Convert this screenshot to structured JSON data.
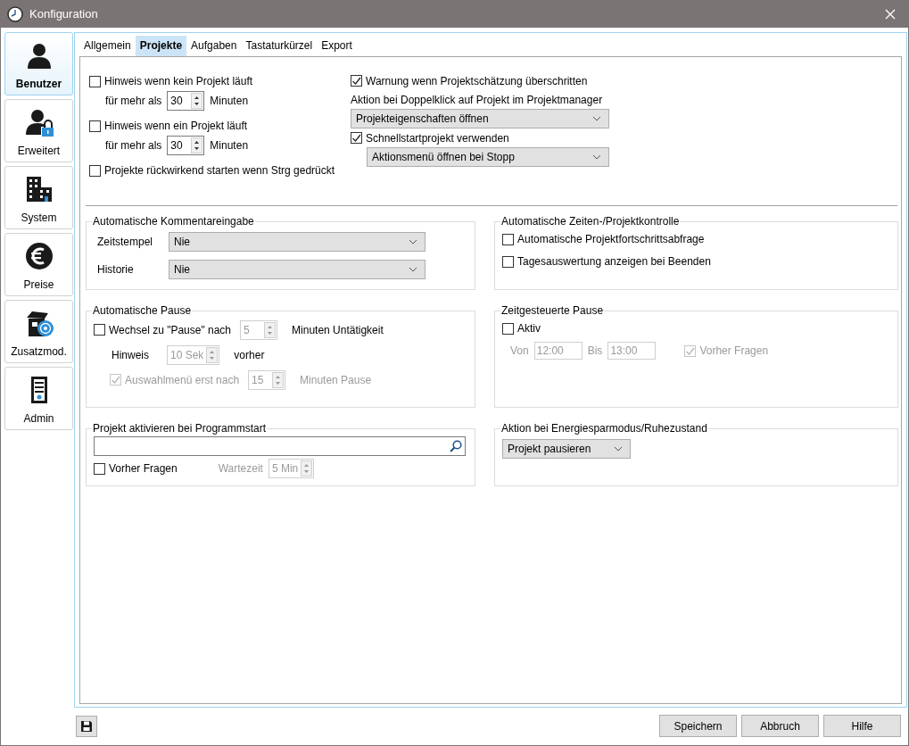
{
  "window": {
    "title": "Konfiguration"
  },
  "sidebar": {
    "items": [
      {
        "label": "Benutzer",
        "kind": "user",
        "selected": true
      },
      {
        "label": "Erweitert",
        "kind": "user-lock",
        "selected": false
      },
      {
        "label": "System",
        "kind": "building",
        "selected": false
      },
      {
        "label": "Preise",
        "kind": "euro",
        "selected": false
      },
      {
        "label": "Zusatzmod.",
        "kind": "box",
        "selected": false
      },
      {
        "label": "Admin",
        "kind": "server",
        "selected": false
      }
    ]
  },
  "tabs": [
    {
      "label": "Allgemein",
      "selected": false
    },
    {
      "label": "Projekte",
      "selected": true
    },
    {
      "label": "Aufgaben",
      "selected": false
    },
    {
      "label": "Tastaturkürzel",
      "selected": false
    },
    {
      "label": "Export",
      "selected": false
    }
  ],
  "top": {
    "left": [
      {
        "kind": "line",
        "items": [
          {
            "kind": "checkbox",
            "label": "Hinweis wenn kein Projekt läuft",
            "checked": false,
            "disabled": false
          }
        ]
      },
      {
        "kind": "indent",
        "items": [
          {
            "kind": "text",
            "text": "für mehr als",
            "disabled": false
          },
          {
            "kind": "spin",
            "value": "30",
            "disabled": false
          },
          {
            "kind": "text",
            "text": "Minuten",
            "disabled": false
          }
        ]
      },
      {
        "kind": "line",
        "items": [
          {
            "kind": "checkbox",
            "label": "Hinweis wenn ein Projekt läuft",
            "checked": false,
            "disabled": false
          }
        ]
      },
      {
        "kind": "indent",
        "items": [
          {
            "kind": "text",
            "text": "für mehr als",
            "disabled": false
          },
          {
            "kind": "spin",
            "value": "30",
            "disabled": false
          },
          {
            "kind": "text",
            "text": "Minuten",
            "disabled": false
          }
        ]
      },
      {
        "kind": "line",
        "items": [
          {
            "kind": "checkbox",
            "label": "Projekte rückwirkend starten wenn Strg gedrückt",
            "checked": false,
            "disabled": false
          }
        ]
      }
    ],
    "right": [
      {
        "kind": "line",
        "items": [
          {
            "kind": "checkbox",
            "label": "Warnung wenn Projektschätzung überschritten",
            "checked": true,
            "disabled": false
          }
        ]
      },
      {
        "kind": "line",
        "items": [
          {
            "kind": "text",
            "text": "Aktion bei Doppelklick auf Projekt im Projektmanager",
            "disabled": false
          }
        ]
      },
      {
        "kind": "line",
        "items": [
          {
            "kind": "select",
            "value": "Projekteigenschaften öffnen"
          }
        ]
      },
      {
        "kind": "line",
        "items": [
          {
            "kind": "checkbox",
            "label": "Schnellstartprojekt verwenden",
            "checked": true,
            "disabled": false
          }
        ]
      },
      {
        "kind": "indent",
        "items": [
          {
            "kind": "select",
            "value": "Aktionsmenü öffnen bei Stopp"
          }
        ]
      }
    ]
  },
  "groups": [
    {
      "title": "Automatische Kommentareingabe",
      "rows": [
        {
          "kind": "line",
          "items": [
            {
              "kind": "label",
              "text": "Zeitstempel",
              "disabled": false
            },
            {
              "kind": "select",
              "value": "Nie"
            }
          ]
        },
        {
          "kind": "line",
          "items": [
            {
              "kind": "label",
              "text": "Historie",
              "disabled": false
            },
            {
              "kind": "select",
              "value": "Nie"
            }
          ]
        }
      ]
    },
    {
      "title": "Automatische Zeiten-/Projektkontrolle",
      "rows": [
        {
          "kind": "line",
          "items": [
            {
              "kind": "checkbox",
              "label": "Automatische Projektfortschrittsabfrage",
              "checked": false,
              "disabled": false
            }
          ]
        },
        {
          "kind": "line",
          "items": [
            {
              "kind": "checkbox",
              "label": "Tagesauswertung anzeigen bei Beenden",
              "checked": false,
              "disabled": false
            }
          ]
        }
      ]
    },
    {
      "title": "Automatische Pause",
      "rows": [
        {
          "kind": "line",
          "items": [
            {
              "kind": "checkbox",
              "label": "Wechsel zu \"Pause\" nach",
              "checked": false,
              "disabled": false
            },
            {
              "kind": "spin",
              "value": "5",
              "disabled": true
            },
            {
              "kind": "text",
              "text": "Minuten Untätigkeit",
              "disabled": false
            }
          ]
        },
        {
          "kind": "indent",
          "items": [
            {
              "kind": "label",
              "text": "Hinweis",
              "disabled": false
            },
            {
              "kind": "spin",
              "value": "10 Sek",
              "disabled": true
            },
            {
              "kind": "text",
              "text": "vorher",
              "disabled": false
            }
          ]
        },
        {
          "kind": "indent",
          "items": [
            {
              "kind": "checkbox",
              "label": "Auswahlmenü erst nach",
              "checked": true,
              "disabled": true
            },
            {
              "kind": "spin",
              "value": "15",
              "disabled": true
            },
            {
              "kind": "text",
              "text": "Minuten Pause",
              "disabled": true
            }
          ]
        }
      ]
    },
    {
      "title": "Zeitgesteuerte Pause",
      "rows": [
        {
          "kind": "line",
          "items": [
            {
              "kind": "checkbox",
              "label": "Aktiv",
              "checked": false,
              "disabled": false
            }
          ]
        },
        {
          "kind": "small-indent",
          "items": [
            {
              "kind": "text",
              "text": "Von",
              "disabled": true
            },
            {
              "kind": "field",
              "value": "12:00",
              "disabled": true
            },
            {
              "kind": "text",
              "text": "Bis",
              "disabled": true
            },
            {
              "kind": "field",
              "value": "13:00",
              "disabled": true
            },
            {
              "kind": "checkbox",
              "label": "Vorher Fragen",
              "checked": true,
              "disabled": true
            }
          ]
        }
      ]
    },
    {
      "title": "Projekt aktivieren bei Programmstart",
      "rows": [
        {
          "kind": "line",
          "items": [
            {
              "kind": "search"
            }
          ]
        },
        {
          "kind": "line",
          "items": [
            {
              "kind": "checkbox",
              "label": "Vorher Fragen",
              "checked": false,
              "disabled": false
            },
            {
              "kind": "label",
              "text": "Wartezeit",
              "disabled": true
            },
            {
              "kind": "spin",
              "value": "5 Min",
              "disabled": true
            }
          ]
        }
      ]
    },
    {
      "title": "Aktion bei Energiesparmodus/Ruhezustand",
      "rows": [
        {
          "kind": "line",
          "items": [
            {
              "kind": "select",
              "value": "Projekt pausieren"
            }
          ]
        }
      ]
    }
  ],
  "buttons": [
    "Speichern",
    "Abbruch",
    "Hilfe"
  ]
}
